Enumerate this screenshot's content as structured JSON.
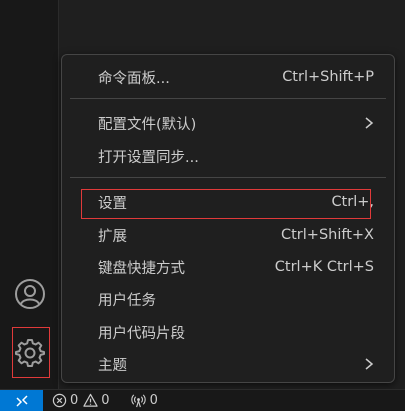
{
  "menu": {
    "items": [
      {
        "label": "命令面板...",
        "shortcut": "Ctrl+Shift+P"
      },
      {
        "label": "配置文件(默认)",
        "submenu": true
      },
      {
        "label": "打开设置同步..."
      },
      {
        "label": "设置",
        "shortcut": "Ctrl+,"
      },
      {
        "label": "扩展",
        "shortcut": "Ctrl+Shift+X"
      },
      {
        "label": "键盘快捷方式",
        "shortcut": "Ctrl+K Ctrl+S"
      },
      {
        "label": "用户任务"
      },
      {
        "label": "用户代码片段"
      },
      {
        "label": "主题",
        "submenu": true
      }
    ]
  },
  "activity_bar": {
    "icons": [
      "account-icon",
      "gear-icon"
    ]
  },
  "status_bar": {
    "errors": "0",
    "warnings": "0",
    "ports": "0"
  },
  "colors": {
    "accent": "#0078d4",
    "highlight": "#e03a3a",
    "background": "#1f1f1f",
    "border": "#454545"
  }
}
